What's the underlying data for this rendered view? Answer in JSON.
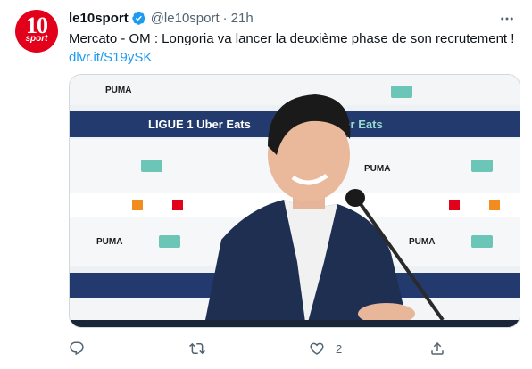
{
  "tweet": {
    "author_name": "le10sport",
    "handle": "@le10sport",
    "separator": "·",
    "time": "21h",
    "text": "Mercato - OM : Longoria va lancer la deuxième phase de son recrutement !",
    "link": "dlvr.it/S19ySK",
    "avatar_logo_top": "10",
    "avatar_logo_bottom": "sport"
  },
  "media": {
    "backdrop_text_row1": "LIGUE 1 Uber Eats",
    "backdrop_text_row2": "Uber Eats",
    "sponsor_puma": "PUMA"
  },
  "actions": {
    "reply_count": "",
    "retweet_count": "",
    "like_count": "2",
    "share_count": ""
  },
  "colors": {
    "accent": "#1d9bf0",
    "avatar_red": "#e3001b",
    "muted": "#536471",
    "text": "#0f1419"
  }
}
